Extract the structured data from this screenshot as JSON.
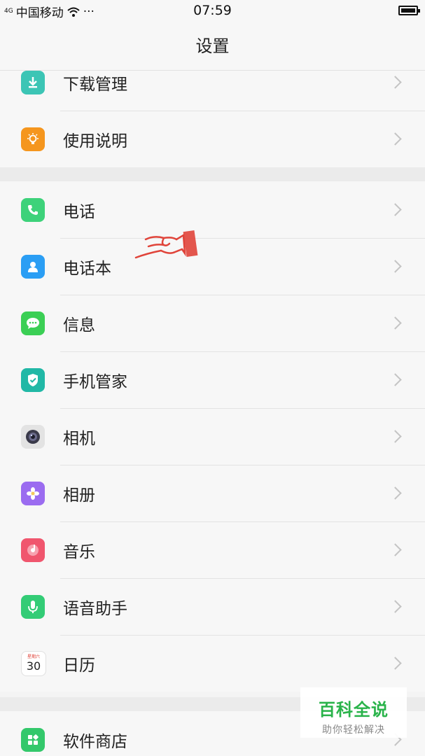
{
  "status_bar": {
    "signal": "4G",
    "carrier": "中国移动",
    "dots": "···",
    "time": "07:59"
  },
  "header": {
    "title": "设置"
  },
  "groups": [
    {
      "items": [
        {
          "label": "下载管理",
          "icon": "download-icon",
          "color": "#3cc5b5"
        },
        {
          "label": "使用说明",
          "icon": "lightbulb-icon",
          "color": "#f5961e"
        }
      ]
    },
    {
      "items": [
        {
          "label": "电话",
          "icon": "phone-icon",
          "color": "#3dd27a"
        },
        {
          "label": "电话本",
          "icon": "contacts-icon",
          "color": "#2b9ef4"
        },
        {
          "label": "信息",
          "icon": "message-icon",
          "color": "#3bcf55"
        },
        {
          "label": "手机管家",
          "icon": "shield-icon",
          "color": "#21b8a6"
        },
        {
          "label": "相机",
          "icon": "camera-icon",
          "color": "#e3e3e3"
        },
        {
          "label": "相册",
          "icon": "flower-icon",
          "color": "#9b6cf0"
        },
        {
          "label": "音乐",
          "icon": "music-icon",
          "color": "#f0566e"
        },
        {
          "label": "语音助手",
          "icon": "microphone-icon",
          "color": "#33cc76"
        },
        {
          "label": "日历",
          "icon": "calendar-icon",
          "color": "#ffffff",
          "calendar_weekday": "星期六",
          "calendar_day": "30"
        }
      ]
    },
    {
      "items": [
        {
          "label": "软件商店",
          "icon": "store-icon",
          "color": "#33c86b"
        }
      ]
    }
  ],
  "watermark": {
    "title": "百科全说",
    "subtitle": "助你轻松解决"
  }
}
